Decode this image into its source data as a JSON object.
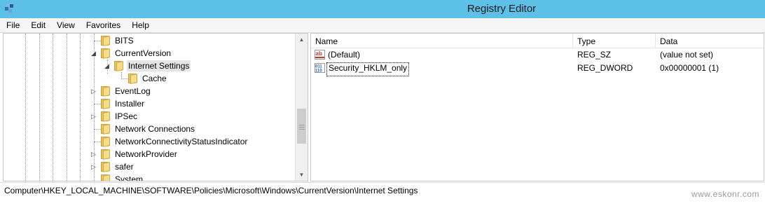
{
  "window": {
    "title": "Registry Editor"
  },
  "menu": [
    "File",
    "Edit",
    "View",
    "Favorites",
    "Help"
  ],
  "tree": {
    "items": [
      {
        "label": "BITS",
        "expander": ""
      },
      {
        "label": "CurrentVersion",
        "expander": "◢"
      },
      {
        "label": "Internet Settings",
        "expander": "◢",
        "selected": true
      },
      {
        "label": "Cache",
        "expander": ""
      },
      {
        "label": "EventLog",
        "expander": "▷"
      },
      {
        "label": "Installer",
        "expander": ""
      },
      {
        "label": "IPSec",
        "expander": "▷"
      },
      {
        "label": "Network Connections",
        "expander": ""
      },
      {
        "label": "NetworkConnectivityStatusIndicator",
        "expander": ""
      },
      {
        "label": "NetworkProvider",
        "expander": "▷"
      },
      {
        "label": "safer",
        "expander": "▷"
      },
      {
        "label": "System",
        "expander": ""
      }
    ]
  },
  "values": {
    "headers": {
      "name": "Name",
      "type": "Type",
      "data": "Data"
    },
    "rows": [
      {
        "icon": "string-value-icon",
        "name": "(Default)",
        "type": "REG_SZ",
        "data": "(value not set)"
      },
      {
        "icon": "binary-value-icon",
        "name": "Security_HKLM_only",
        "type": "REG_DWORD",
        "data": "0x00000001 (1)"
      }
    ]
  },
  "status": {
    "path": "Computer\\HKEY_LOCAL_MACHINE\\SOFTWARE\\Policies\\Microsoft\\Windows\\CurrentVersion\\Internet Settings"
  },
  "watermark": "www.eskonr.com"
}
